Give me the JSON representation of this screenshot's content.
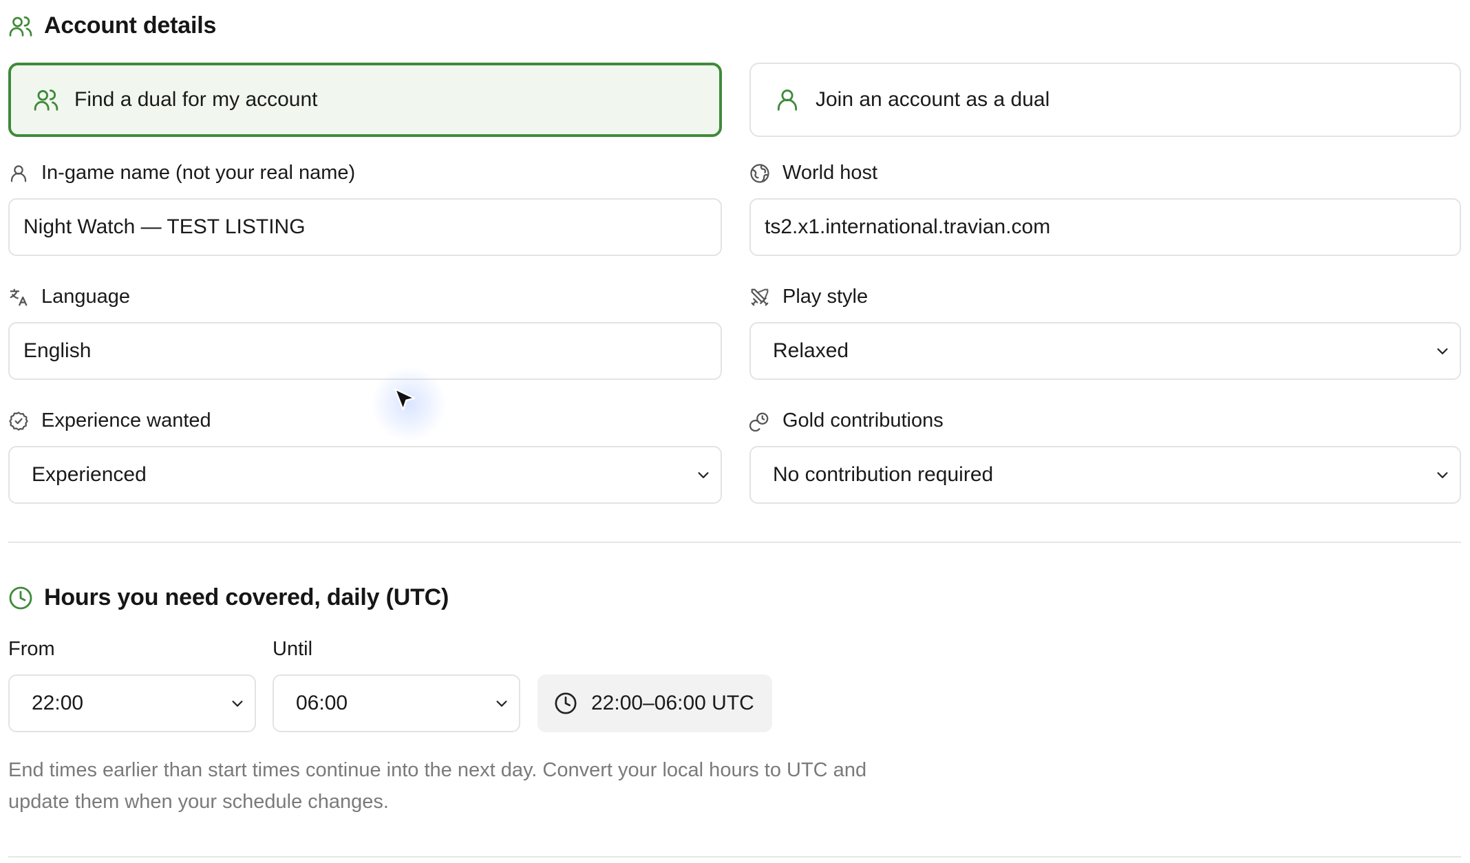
{
  "account_section": {
    "title": "Account details",
    "icon": "users-icon"
  },
  "mode": {
    "find_dual_label": "Find a dual for my account",
    "join_dual_label": "Join an account as a dual",
    "selected": "find_dual"
  },
  "fields": {
    "ign": {
      "label": "In-game name (not your real name)",
      "value": "Night Watch — TEST LISTING"
    },
    "world_host": {
      "label": "World host",
      "value": "ts2.x1.international.travian.com"
    },
    "language": {
      "label": "Language",
      "value": "English"
    },
    "play_style": {
      "label": "Play style",
      "value": "Relaxed"
    },
    "experience": {
      "label": "Experience wanted",
      "value": "Experienced"
    },
    "gold": {
      "label": "Gold contributions",
      "value": "No contribution required"
    }
  },
  "hours_section": {
    "title": "Hours you need covered, daily (UTC)",
    "from_label": "From",
    "from_value": "22:00",
    "until_label": "Until",
    "until_value": "06:00",
    "summary": "22:00–06:00 UTC",
    "hint": "End times earlier than start times continue into the next day. Convert your local hours to UTC and update them when your schedule changes."
  },
  "colors": {
    "accent_green": "#3f8a3a",
    "selected_bg": "#f1f7ee",
    "border": "#e3e3e3",
    "muted_text": "#7a7a7a"
  }
}
